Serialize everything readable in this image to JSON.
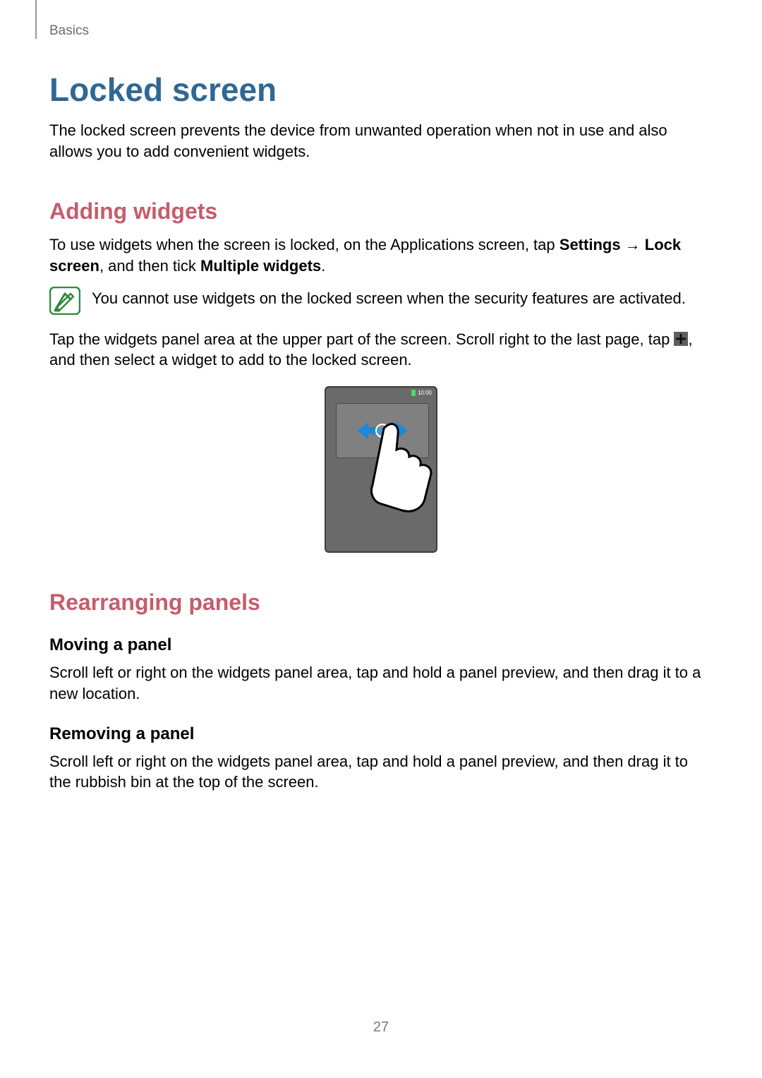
{
  "breadcrumb": "Basics",
  "h1": "Locked screen",
  "intro": "The locked screen prevents the device from unwanted operation when not in use and also allows you to add convenient widgets.",
  "adding": {
    "heading": "Adding widgets",
    "p1_pre": "To use widgets when the screen is locked, on the Applications screen, tap ",
    "p1_b1": "Settings",
    "p1_arrow": " → ",
    "p1_b2": "Lock screen",
    "p1_mid": ", and then tick ",
    "p1_b3": "Multiple widgets",
    "p1_post": ".",
    "note": "You cannot use widgets on the locked screen when the security features are activated.",
    "p2_pre": "Tap the widgets panel area at the upper part of the screen. Scroll right to the last page, tap ",
    "p2_post": ", and then select a widget to add to the locked screen."
  },
  "figure": {
    "status_time": "10:00"
  },
  "rearranging": {
    "heading": "Rearranging panels",
    "moving_h": "Moving a panel",
    "moving_p": "Scroll left or right on the widgets panel area, tap and hold a panel preview, and then drag it to a new location.",
    "removing_h": "Removing a panel",
    "removing_p": "Scroll left or right on the widgets panel area, tap and hold a panel preview, and then drag it to the rubbish bin at the top of the screen."
  },
  "page_number": "27"
}
